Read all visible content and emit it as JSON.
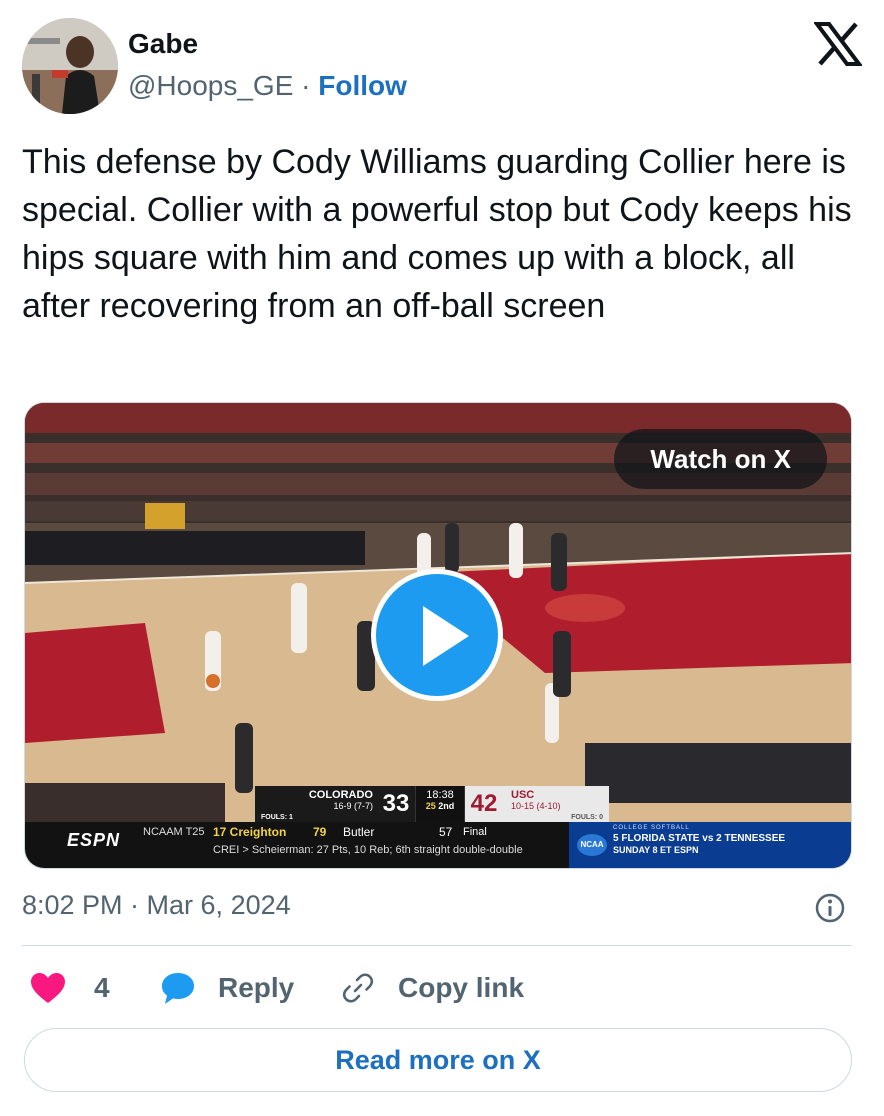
{
  "author": {
    "name": "Gabe",
    "handle": "@Hoops_GE",
    "separator": "·",
    "follow_label": "Follow"
  },
  "platform_icon": "x-logo-icon",
  "tweet": {
    "text": "This defense by Cody Williams guarding Collier here is special. Collier with a powerful stop but Cody keeps his hips square with him and comes up with a block, all after recovering from an off-ball screen"
  },
  "media": {
    "watch_label": "Watch on X",
    "play_icon": "play-icon",
    "scoreboard": {
      "away_team": "COLORADO",
      "away_record": "16-9 (7-7)",
      "away_fouls": "FOULS: 1",
      "away_score": "33",
      "clock": "18:38",
      "shot_clock": "25",
      "period": "2nd",
      "home_score": "42",
      "home_team": "USC",
      "home_record": "10-15 (4-10)",
      "home_fouls": "FOULS: 0"
    },
    "ticker": {
      "network": "ESPN",
      "league": "NCAAM T25",
      "team1": "17 Creighton",
      "score1": "79",
      "team2": "Butler",
      "score2": "57",
      "status": "Final",
      "note": "CREI  >  Scheierman: 27 Pts, 10 Reb; 6th straight double-double",
      "promo_badge": "NCAA",
      "promo_line1": "COLLEGE SOFTBALL",
      "promo_line2": "5 FLORIDA STATE vs 2 TENNESSEE",
      "promo_line3": "SUNDAY 8 ET  ESPN"
    }
  },
  "timestamp": "8:02 PM · Mar 6, 2024",
  "info_icon": "info-icon",
  "actions": {
    "like_count": "4",
    "reply_label": "Reply",
    "copy_label": "Copy link"
  },
  "read_more_label": "Read more on X",
  "colors": {
    "accent": "#1d9bf0",
    "link": "#1d6fbf",
    "like": "#f91880",
    "muted": "#536471"
  }
}
